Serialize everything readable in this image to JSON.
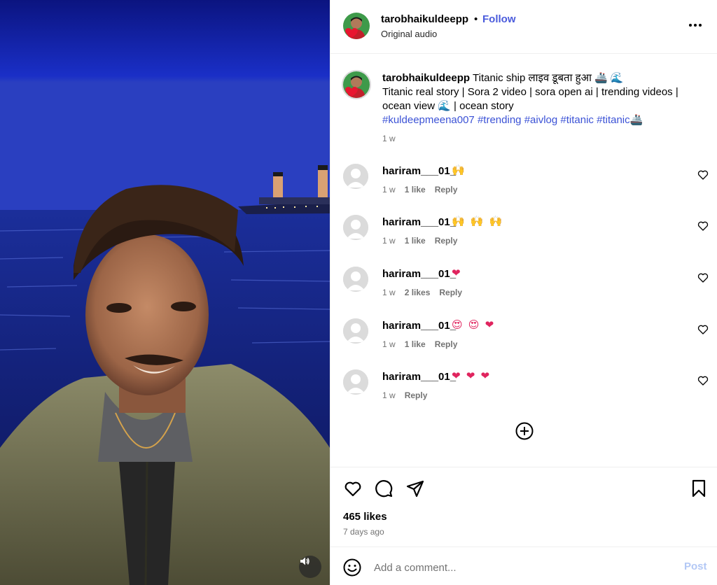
{
  "header": {
    "username": "tarobhaikuldeepp",
    "separator": "•",
    "follow_label": "Follow",
    "audio_label": "Original audio"
  },
  "caption": {
    "username": "tarobhaikuldeepp",
    "line1": "Titanic ship लाइव डूबता हुआ 🚢 🌊",
    "line2": "Titanic real story | Sora 2 video | sora open ai | trending videos |",
    "line3": "ocean view 🌊 | ocean story",
    "hashtags": [
      "#kuldeepmeena007",
      "#trending",
      "#aivlog",
      "#titanic",
      "#titanic"
    ],
    "trailing_emoji": "🚢",
    "time": "1 w"
  },
  "comments": [
    {
      "username": "hariram___01_",
      "emoji": "🙌",
      "time": "1 w",
      "likes": "1 like",
      "reply": "Reply"
    },
    {
      "username": "hariram___01_",
      "emoji": "🙌 🙌 🙌",
      "time": "1 w",
      "likes": "1 like",
      "reply": "Reply"
    },
    {
      "username": "hariram___01_",
      "emoji": "❤",
      "time": "1 w",
      "likes": "2 likes",
      "reply": "Reply"
    },
    {
      "username": "hariram___01_",
      "emoji": "😍 😍 ❤",
      "time": "1 w",
      "likes": "1 like",
      "reply": "Reply"
    },
    {
      "username": "hariram___01_",
      "emoji": "❤ ❤ ❤",
      "time": "1 w",
      "likes": "",
      "reply": "Reply"
    }
  ],
  "footer": {
    "likes_count": "465 likes",
    "posted_ago": "7 days ago",
    "comment_placeholder": "Add a comment...",
    "post_label": "Post"
  },
  "colors": {
    "follow": "#4a5bdc",
    "hashtag": "#3b52d6",
    "post_disabled": "#b3c8f5",
    "secondary_text": "#737373",
    "heart_emoji": "#e0245e"
  },
  "icons": {
    "header_more": "more-horizontal-icon",
    "comment_like": "heart-outline-icon",
    "load_more": "plus-circle-icon",
    "like": "heart-icon",
    "comment": "comment-bubble-icon",
    "share": "paper-plane-icon",
    "save": "bookmark-icon",
    "emoji_picker": "smiley-icon",
    "audio": "speaker-icon"
  }
}
